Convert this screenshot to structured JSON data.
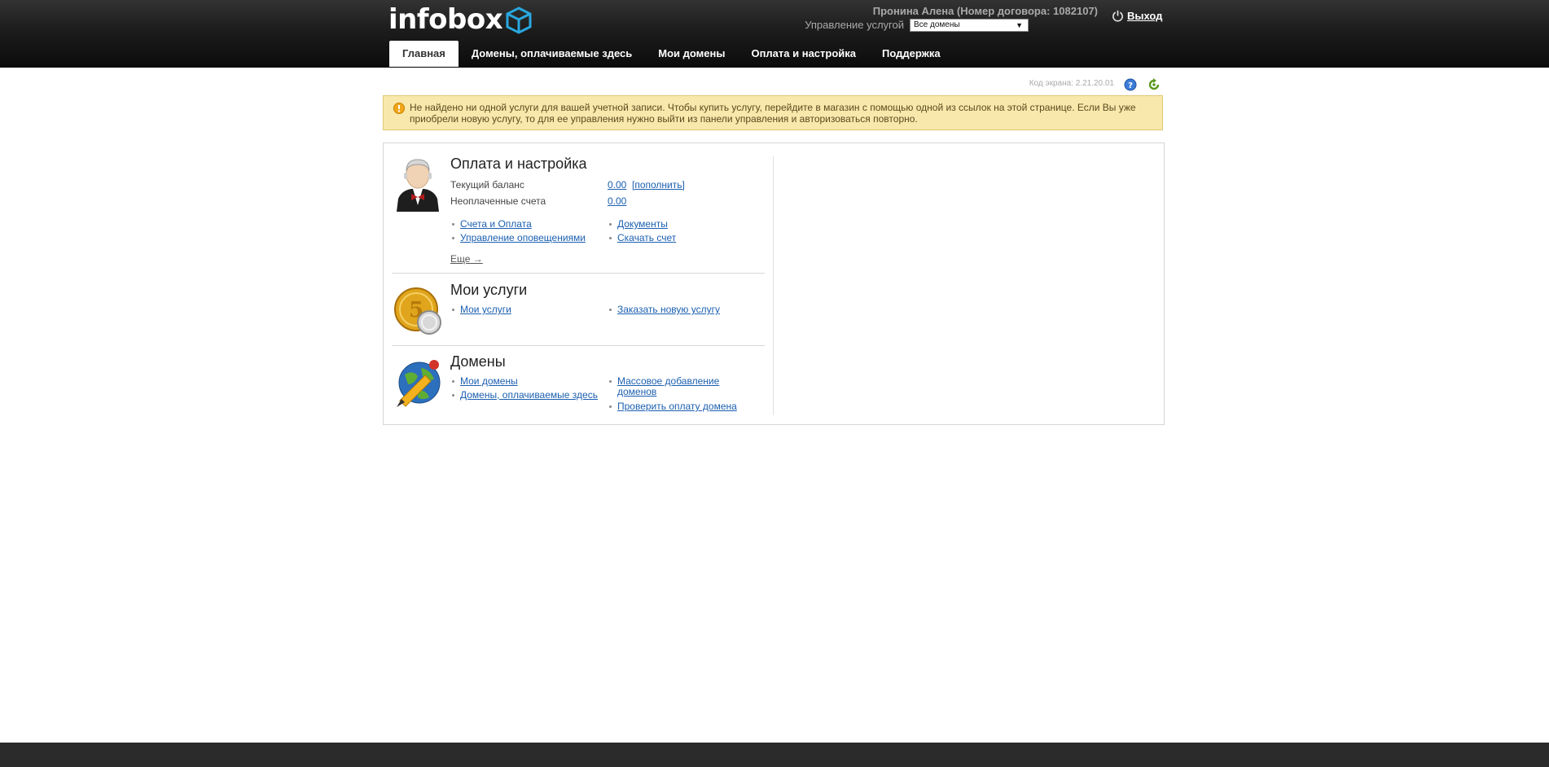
{
  "header": {
    "logo": "infobox",
    "user": "Пронина Алена (Номер договора: 1082107)",
    "service_label": "Управление услугой",
    "service_select": "Все домены",
    "logout": "Выход",
    "tabs": [
      {
        "label": "Главная",
        "active": true
      },
      {
        "label": "Домены, оплачиваемые здесь"
      },
      {
        "label": "Мои домены"
      },
      {
        "label": "Оплата и настройка"
      },
      {
        "label": "Поддержка"
      }
    ]
  },
  "screen_code": "Код экрана:  2.21.20.01",
  "alert": {
    "text": "Не найдено ни одной услуги для вашей учетной записи. Чтобы купить услугу, перейдите в магазин с помощью одной из ссылок на этой странице. Если Вы уже приобрели новую услугу, то для ее управления нужно выйти из панели управления и авторизоваться повторно."
  },
  "billing": {
    "title": "Оплата и настройка",
    "balance_label": "Текущий баланс",
    "balance_value": "0.00",
    "topup": "[пополнить]",
    "unpaid_label": "Неоплаченные счета",
    "unpaid_value": "0.00",
    "links_left": [
      "Счета и Оплата",
      "Управление оповещениями"
    ],
    "links_right": [
      "Документы",
      "Скачать счет"
    ],
    "more": "Еще →"
  },
  "services": {
    "title": "Мои услуги",
    "link_left": "Мои услуги",
    "link_right": "Заказать новую услугу"
  },
  "domains": {
    "title": "Домены",
    "links_left": [
      "Мои домены",
      "Домены, оплачиваемые здесь"
    ],
    "links_right_1a": "Массовое добавление",
    "links_right_1b": "доменов",
    "links_right_2": "Проверить оплату домена"
  },
  "colors": {
    "accent": "#1b5fb0",
    "alert_bg": "#f9e8ab",
    "cube": "#29a8e0"
  }
}
